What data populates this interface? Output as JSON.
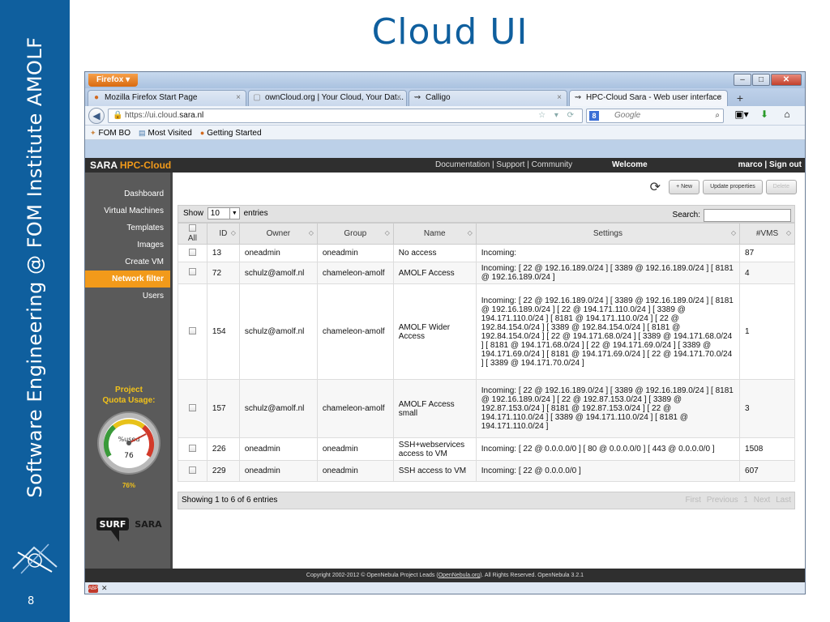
{
  "slide": {
    "title": "Cloud UI",
    "side_text": "Software Engineering  @  FOM Institute AMOLF",
    "slide_number": "8"
  },
  "browser": {
    "firefox_button": "Firefox",
    "tabs": [
      {
        "label": "Mozilla Firefox Start Page",
        "icon": "firefox-icon"
      },
      {
        "label": "ownCloud.org | Your Cloud, Your Dat...",
        "icon": "page-icon"
      },
      {
        "label": "Calligo",
        "icon": "site-icon"
      },
      {
        "label": "HPC-Cloud Sara - Web user interface",
        "icon": "site-icon"
      }
    ],
    "url_prefix": "https://ui.cloud.",
    "url_host": "sara.nl",
    "search_placeholder": "Google",
    "bookmarks": [
      "FOM BO",
      "Most Visited",
      "Getting Started"
    ]
  },
  "app": {
    "brand_main": "SARA",
    "brand_hl": "HPC-Cloud",
    "header_links": "Documentation | Support | Community",
    "welcome": "Welcome",
    "user": "marco | Sign out",
    "sidebar": [
      {
        "label": "Dashboard",
        "active": false
      },
      {
        "label": "Virtual Machines",
        "active": false
      },
      {
        "label": "Templates",
        "active": false
      },
      {
        "label": "Images",
        "active": false
      },
      {
        "label": "Create VM",
        "active": false
      },
      {
        "label": "Network filter",
        "active": true
      },
      {
        "label": "Users",
        "active": false
      }
    ],
    "quota_title": "Project\nQuota Usage:",
    "gauge_label": "%used",
    "gauge_value": "76",
    "quota_percent": "76%",
    "quota_fraction": 0.76,
    "surf_logo": "SURF SARA",
    "actions": {
      "new": "+ New",
      "update": "Update properties",
      "delete": "Delete"
    },
    "table": {
      "show_label": "Show",
      "entries_value": "10",
      "entries_label": "entries",
      "search_label": "Search:",
      "headers": [
        "All",
        "ID",
        "Owner",
        "Group",
        "Name",
        "Settings",
        "#VMS"
      ],
      "rows": [
        {
          "id": "13",
          "owner": "oneadmin",
          "group": "oneadmin",
          "name": "No access",
          "settings": "Incoming:",
          "vms": "87"
        },
        {
          "id": "72",
          "owner": "schulz@amolf.nl",
          "group": "chameleon-amolf",
          "name": "AMOLF Access",
          "settings": "Incoming: [ 22 @ 192.16.189.0/24 ] [ 3389 @ 192.16.189.0/24 ] [ 8181 @ 192.16.189.0/24 ]",
          "vms": "4"
        },
        {
          "id": "154",
          "owner": "schulz@amolf.nl",
          "group": "chameleon-amolf",
          "name": "AMOLF Wider Access",
          "settings": "Incoming: [ 22 @ 192.16.189.0/24 ] [ 3389 @ 192.16.189.0/24 ] [ 8181 @ 192.16.189.0/24 ] [ 22 @ 194.171.110.0/24 ] [ 3389 @ 194.171.110.0/24 ] [ 8181 @ 194.171.110.0/24 ] [ 22 @ 192.84.154.0/24 ] [ 3389 @ 192.84.154.0/24 ] [ 8181 @ 192.84.154.0/24 ] [ 22 @ 194.171.68.0/24 ] [ 3389 @ 194.171.68.0/24 ] [ 8181 @ 194.171.68.0/24 ] [ 22 @ 194.171.69.0/24 ] [ 3389 @ 194.171.69.0/24 ] [ 8181 @ 194.171.69.0/24 ] [ 22 @ 194.171.70.0/24 ] [ 3389 @ 194.171.70.0/24 ]",
          "vms": "1"
        },
        {
          "id": "157",
          "owner": "schulz@amolf.nl",
          "group": "chameleon-amolf",
          "name": "AMOLF Access small",
          "settings": "Incoming: [ 22 @ 192.16.189.0/24 ] [ 3389 @ 192.16.189.0/24 ] [ 8181 @ 192.16.189.0/24 ] [ 22 @ 192.87.153.0/24 ] [ 3389 @ 192.87.153.0/24 ] [ 8181 @ 192.87.153.0/24 ] [ 22 @ 194.171.110.0/24 ] [ 3389 @ 194.171.110.0/24 ] [ 8181 @ 194.171.110.0/24 ]",
          "vms": "3"
        },
        {
          "id": "226",
          "owner": "oneadmin",
          "group": "oneadmin",
          "name": "SSH+webservices access to VM",
          "settings": "Incoming: [ 22 @ 0.0.0.0/0 ] [ 80 @ 0.0.0.0/0 ] [ 443 @ 0.0.0.0/0 ]",
          "vms": "1508"
        },
        {
          "id": "229",
          "owner": "oneadmin",
          "group": "oneadmin",
          "name": "SSH access to VM",
          "settings": "Incoming: [ 22 @ 0.0.0.0/0 ]",
          "vms": "607"
        }
      ],
      "info": "Showing 1 to 6 of 6 entries",
      "pager": [
        "First",
        "Previous",
        "1",
        "Next",
        "Last"
      ]
    },
    "footer_pre": "Copyright 2002-2012 © OpenNebula Project Leads (",
    "footer_link": "OpenNebula.org",
    "footer_post": "). All Rights Reserved. OpenNebula 3.2.1"
  },
  "colors": {
    "slide_blue": "#0f5f9e",
    "accent_orange": "#f29a1a"
  }
}
